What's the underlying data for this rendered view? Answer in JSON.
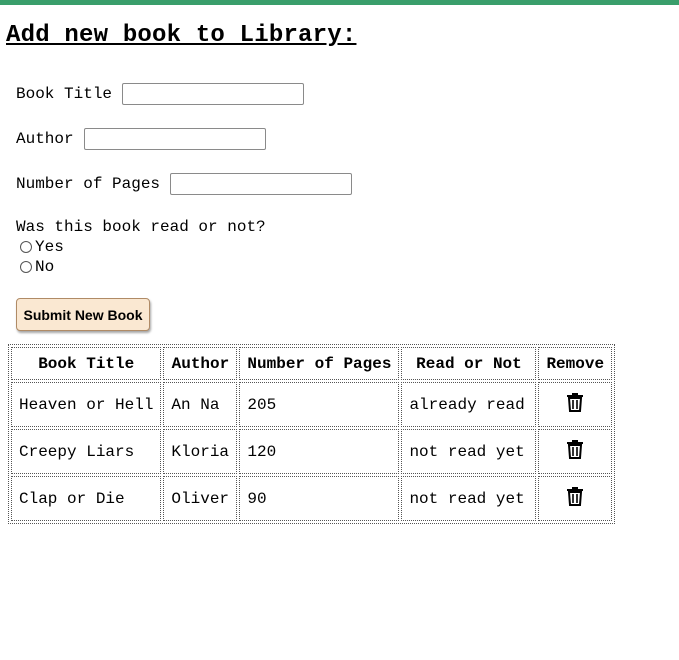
{
  "page": {
    "heading": "Add new book to Library:"
  },
  "form": {
    "title_label": "Book Title",
    "title_value": "",
    "author_label": "Author",
    "author_value": "",
    "pages_label": "Number of Pages",
    "pages_value": "",
    "read_question": "Was this book read or not?",
    "read_options": [
      {
        "label": "Yes",
        "checked": false
      },
      {
        "label": "No",
        "checked": false
      }
    ],
    "submit_label": "Submit New Book"
  },
  "table": {
    "headers": [
      "Book Title",
      "Author",
      "Number of Pages",
      "Read or Not",
      "Remove"
    ],
    "rows": [
      {
        "title": "Heaven or Hell",
        "author": "An Na",
        "pages": "205",
        "read": "already read",
        "remove_icon": "trash-icon"
      },
      {
        "title": "Creepy Liars",
        "author": "Kloria",
        "pages": "120",
        "read": "not read yet",
        "remove_icon": "trash-icon"
      },
      {
        "title": "Clap or Die",
        "author": "Oliver",
        "pages": "90",
        "read": "not read yet",
        "remove_icon": "trash-icon"
      }
    ]
  },
  "colors": {
    "top_bar": "#3a9e6b",
    "submit_bg": "#fae8d2"
  }
}
